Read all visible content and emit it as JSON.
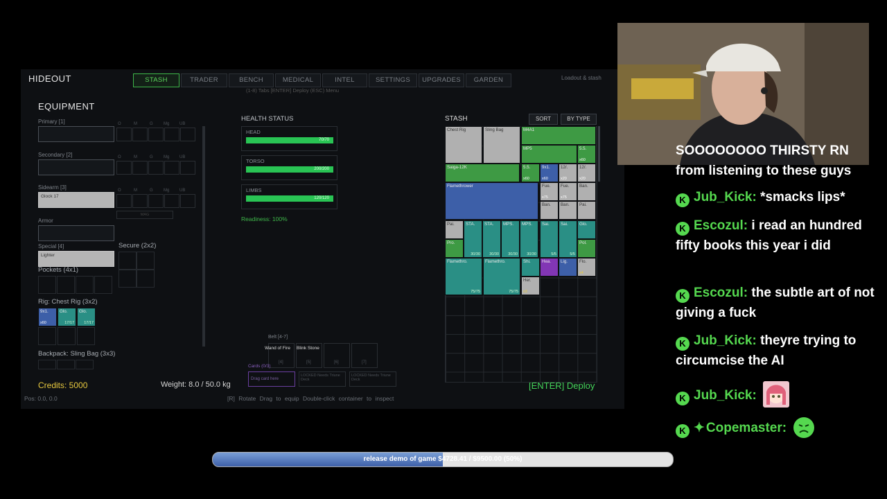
{
  "game": {
    "title": "HIDEOUT",
    "tabs": [
      "STASH",
      "TRADER",
      "BENCH",
      "MEDICAL",
      "INTEL",
      "SETTINGS",
      "UPGRADES",
      "GARDEN"
    ],
    "top_right": "Loadout & stash",
    "hint": "(1-8) Tabs [ENTER] Deploy (ESC) Menu",
    "equipment_title": "EQUIPMENT",
    "slots": {
      "primary": "Primary [1]",
      "secondary": "Secondary [2]",
      "sidearm": "Sidearm [3]",
      "sidearm_item": "Glock 17",
      "armor": "Armor",
      "special": "Special [4]",
      "special_item": "Lighter",
      "secure": "Secure (2x2)",
      "pockets": "Pockets (4x1)",
      "rig": "Rig: Chest Rig (3x2)",
      "backpack": "Backpack: Sling Bag (3x3)",
      "mini_labels": [
        "O",
        "M",
        "G",
        "Mg",
        "UB"
      ],
      "mag_btn": "MAG"
    },
    "rig_items": [
      {
        "name": "9x1.",
        "qty": "x60"
      },
      {
        "name": "Glo.",
        "qty": "17/17"
      },
      {
        "name": "Glo.",
        "qty": "17/17"
      }
    ],
    "credits": "Credits: 5000",
    "weight": "Weight: 8.0 / 50.0 kg",
    "pos": "Pos: 0.0, 0.0",
    "footer_hints": "[R] Rotate   Drag to equip   Double-click container to inspect",
    "deploy": "[ENTER] Deploy",
    "health": {
      "title": "HEALTH STATUS",
      "parts": [
        {
          "name": "HEAD",
          "value": "70/70"
        },
        {
          "name": "TORSO",
          "value": "200/200"
        },
        {
          "name": "LIMBS",
          "value": "120/120"
        }
      ],
      "readiness": "Readiness: 100%"
    },
    "belt": {
      "title": "Belt [4-7]",
      "items": [
        "Wand of Fire",
        "Blink Stone"
      ],
      "keys": [
        "[4]",
        "[5]",
        "[6]",
        "[7]"
      ]
    },
    "cards": {
      "title": "Cards (0/3)",
      "slots": [
        "Drag card here",
        "LOCKED Needs Triune Deck",
        "LOCKED Needs Triune Deck"
      ]
    },
    "stash": {
      "title": "STASH",
      "sort": "SORT",
      "by_type": "BY TYPE",
      "items": [
        {
          "name": "Chest Rig",
          "qty": ""
        },
        {
          "name": "Sling Bag",
          "qty": ""
        },
        {
          "name": "M4A1",
          "qty": ""
        },
        {
          "name": "MP5",
          "qty": ""
        },
        {
          "name": "5.5.",
          "qty": "x60"
        },
        {
          "name": "Saiga-12K",
          "qty": ""
        },
        {
          "name": "5.5.",
          "qty": "x60"
        },
        {
          "name": "9x1.",
          "qty": "x60"
        },
        {
          "name": "12/.",
          "qty": "x20"
        },
        {
          "name": "12/.",
          "qty": "x20"
        },
        {
          "name": "Flamethrower",
          "qty": ""
        },
        {
          "name": "Fue.",
          "qty": "x75"
        },
        {
          "name": "Fue.",
          "qty": "x75"
        },
        {
          "name": "Ban.",
          "qty": ""
        },
        {
          "name": "Ban.",
          "qty": ""
        },
        {
          "name": "Ban.",
          "qty": ""
        },
        {
          "name": "Pai.",
          "qty": ""
        },
        {
          "name": "Pai.",
          "qty": ""
        },
        {
          "name": "STA.",
          "qty": "30/30"
        },
        {
          "name": "STA.",
          "qty": "30/30"
        },
        {
          "name": "MPS.",
          "qty": "30/30"
        },
        {
          "name": "MPS.",
          "qty": "30/30"
        },
        {
          "name": "Sai.",
          "qty": "5/5"
        },
        {
          "name": "Sai.",
          "qty": "5/5"
        },
        {
          "name": "Glo.",
          "qty": ""
        },
        {
          "name": "Pro.",
          "qty": ""
        },
        {
          "name": "Pol.",
          "qty": ""
        },
        {
          "name": "Flamethro.",
          "qty": "75/75"
        },
        {
          "name": "Flamethro.",
          "qty": "75/75"
        },
        {
          "name": "Shi.",
          "qty": ""
        },
        {
          "name": "Hea.",
          "qty": ""
        },
        {
          "name": "Lig.",
          "qty": ""
        },
        {
          "name": "Flo.",
          "qty": "x4"
        },
        {
          "name": "Her.",
          "qty": "x3"
        }
      ]
    }
  },
  "chat": [
    {
      "user": "",
      "text": "SOOOOOOOO THIRSTY RN from listening to these guys"
    },
    {
      "user": "Jub_Kick:",
      "text": "*smacks lips*"
    },
    {
      "user": "Escozul:",
      "text": "i read an hundred fifty books this year i did"
    },
    {
      "user": "Escozul:",
      "text": "the subtle art of not giving a fuck"
    },
    {
      "user": "Jub_Kick:",
      "text": "theyre trying to circumcise the AI"
    },
    {
      "user": "Jub_Kick:",
      "text": ""
    },
    {
      "user": "Copemaster:",
      "text": ""
    }
  ],
  "progress": {
    "text": "release demo of game $4728.41 / $9500.00 (50%)",
    "fraction": 0.5
  },
  "colors": {
    "accent": "#3fb84a",
    "health": "#29c454",
    "chat_name": "#55d84f"
  }
}
